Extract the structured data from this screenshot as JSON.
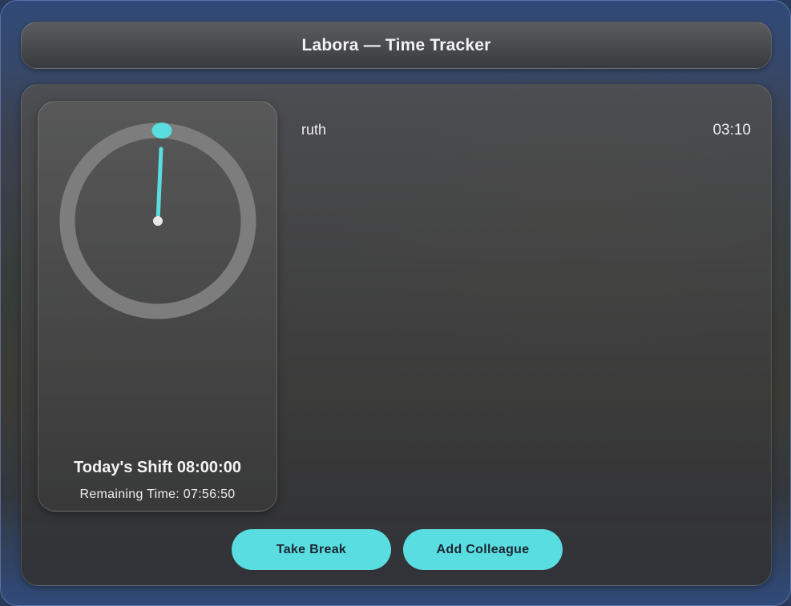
{
  "window": {
    "title": "Labora — Time Tracker"
  },
  "clock": {
    "shift_label": "Today's Shift 08:00:00",
    "remaining_label": "Remaining Time: 07:56:50",
    "elapsed_fraction": 0.007,
    "accent_color": "#59dde1",
    "ring_color": "#7d7d7d"
  },
  "colleagues": [
    {
      "name": "ruth",
      "time": "03:10"
    }
  ],
  "actions": {
    "take_break_label": "Take Break",
    "add_colleague_label": "Add Colleague"
  }
}
